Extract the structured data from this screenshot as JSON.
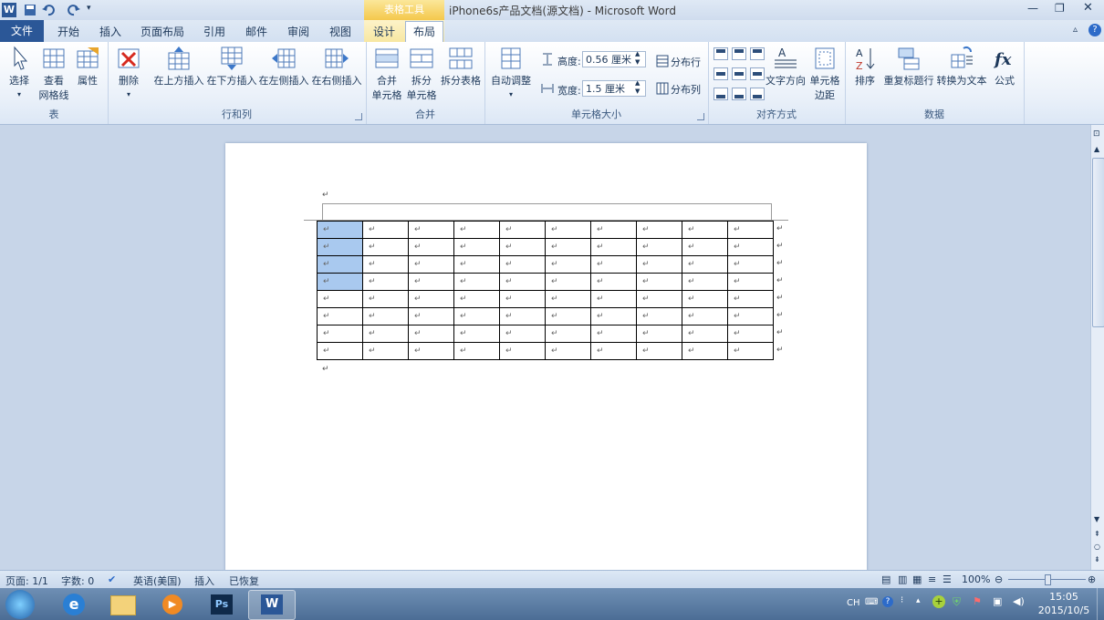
{
  "window": {
    "title": "iPhone6s产品文档(源文档) - Microsoft Word",
    "context_tab_group": "表格工具"
  },
  "quick_access": [
    "save-icon",
    "undo-icon",
    "redo-icon",
    "customize-icon"
  ],
  "tabs": [
    {
      "label": "文件"
    },
    {
      "label": "开始"
    },
    {
      "label": "插入"
    },
    {
      "label": "页面布局"
    },
    {
      "label": "引用"
    },
    {
      "label": "邮件"
    },
    {
      "label": "审阅"
    },
    {
      "label": "视图"
    },
    {
      "label": "设计"
    },
    {
      "label": "布局"
    }
  ],
  "ribbon": {
    "table_group": {
      "label": "表",
      "select": "选择",
      "gridlines_line1": "查看",
      "gridlines_line2": "网格线",
      "properties": "属性"
    },
    "rows_cols_group": {
      "label": "行和列",
      "delete": "删除",
      "insert_above": "在上方插入",
      "insert_below": "在下方插入",
      "insert_left": "在左侧插入",
      "insert_right": "在右侧插入"
    },
    "merge_group": {
      "label": "合并",
      "merge_line1": "合并",
      "merge_line2": "单元格",
      "split_line1": "拆分",
      "split_line2": "单元格",
      "split_table": "拆分表格"
    },
    "cell_size_group": {
      "label": "单元格大小",
      "autofit": "自动调整",
      "height_label": "高度:",
      "height_value": "0.56 厘米",
      "width_label": "宽度:",
      "width_value": "1.5 厘米",
      "distribute_rows": "分布行",
      "distribute_cols": "分布列"
    },
    "align_group": {
      "label": "对齐方式",
      "text_direction": "文字方向",
      "cell_margins_line1": "单元格",
      "cell_margins_line2": "边距"
    },
    "data_group": {
      "label": "数据",
      "sort": "排序",
      "repeat_header": "重复标题行",
      "convert_text": "转换为文本",
      "formula": "公式"
    }
  },
  "document": {
    "paragraph_mark": "↵",
    "table": {
      "rows": 8,
      "cols": 10,
      "selected_cells": [
        [
          0,
          0
        ],
        [
          1,
          0
        ],
        [
          2,
          0
        ],
        [
          3,
          0
        ]
      ]
    }
  },
  "status": {
    "page": "页面: 1/1",
    "words": "字数: 0",
    "language": "英语(美国)",
    "mode": "插入",
    "recovered": "已恢复",
    "zoom": "100%"
  },
  "taskbar": {
    "tray_lang": "CH",
    "time": "15:05",
    "date": "2015/10/5"
  }
}
